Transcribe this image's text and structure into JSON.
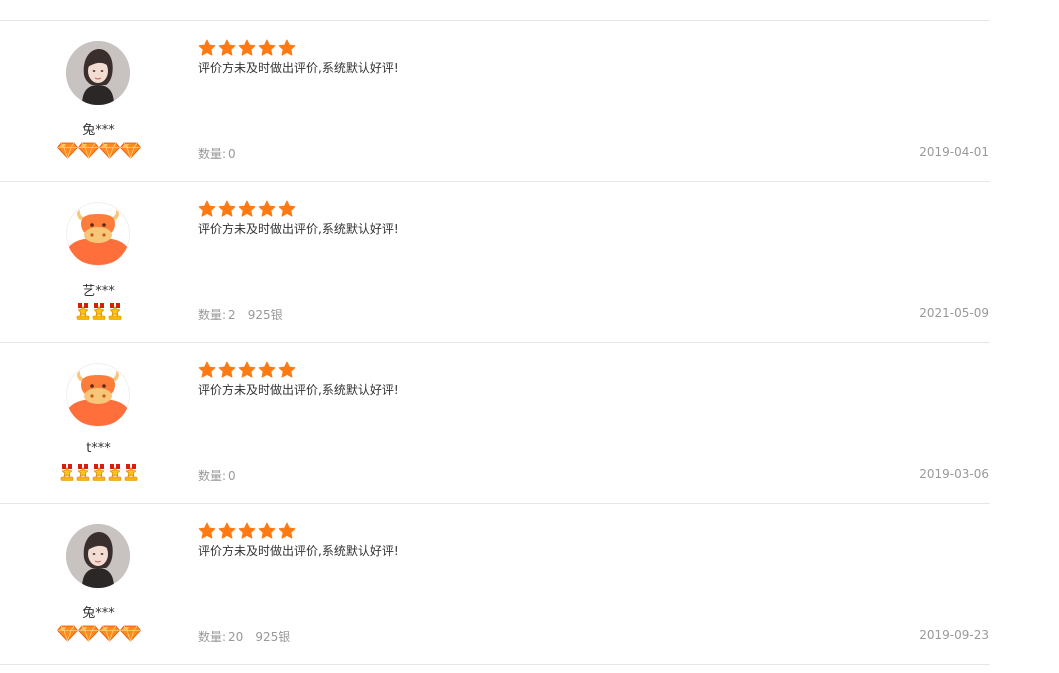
{
  "reviews": [
    {
      "avatar": "woman-photo-avatar",
      "user": "兔***",
      "badge_type": "diamond",
      "badge_count": 4,
      "rating": 5,
      "comment": "评价方未及时做出评价,系统默认好评!",
      "quantity_label": "数量:",
      "quantity": "0",
      "material": "",
      "date": "2019-04-01"
    },
    {
      "avatar": "cartoon-ox-avatar",
      "user": "艺***",
      "badge_type": "medal-star",
      "badge_count": 3,
      "rating": 5,
      "comment": "评价方未及时做出评价,系统默认好评!",
      "quantity_label": "数量:",
      "quantity": "2",
      "material": "925银",
      "date": "2021-05-09"
    },
    {
      "avatar": "cartoon-ox-avatar",
      "user": "t***",
      "badge_type": "medal-star",
      "badge_count": 5,
      "rating": 5,
      "comment": "评价方未及时做出评价,系统默认好评!",
      "quantity_label": "数量:",
      "quantity": "0",
      "material": "",
      "date": "2019-03-06"
    },
    {
      "avatar": "woman-photo-avatar",
      "user": "兔***",
      "badge_type": "diamond",
      "badge_count": 4,
      "rating": 5,
      "comment": "评价方未及时做出评价,系统默认好评!",
      "quantity_label": "数量:",
      "quantity": "20",
      "material": "925银",
      "date": "2019-09-23"
    }
  ],
  "colors": {
    "star": "#ff7a12",
    "separator": "#e6e6e6",
    "meta_text": "#999999"
  }
}
